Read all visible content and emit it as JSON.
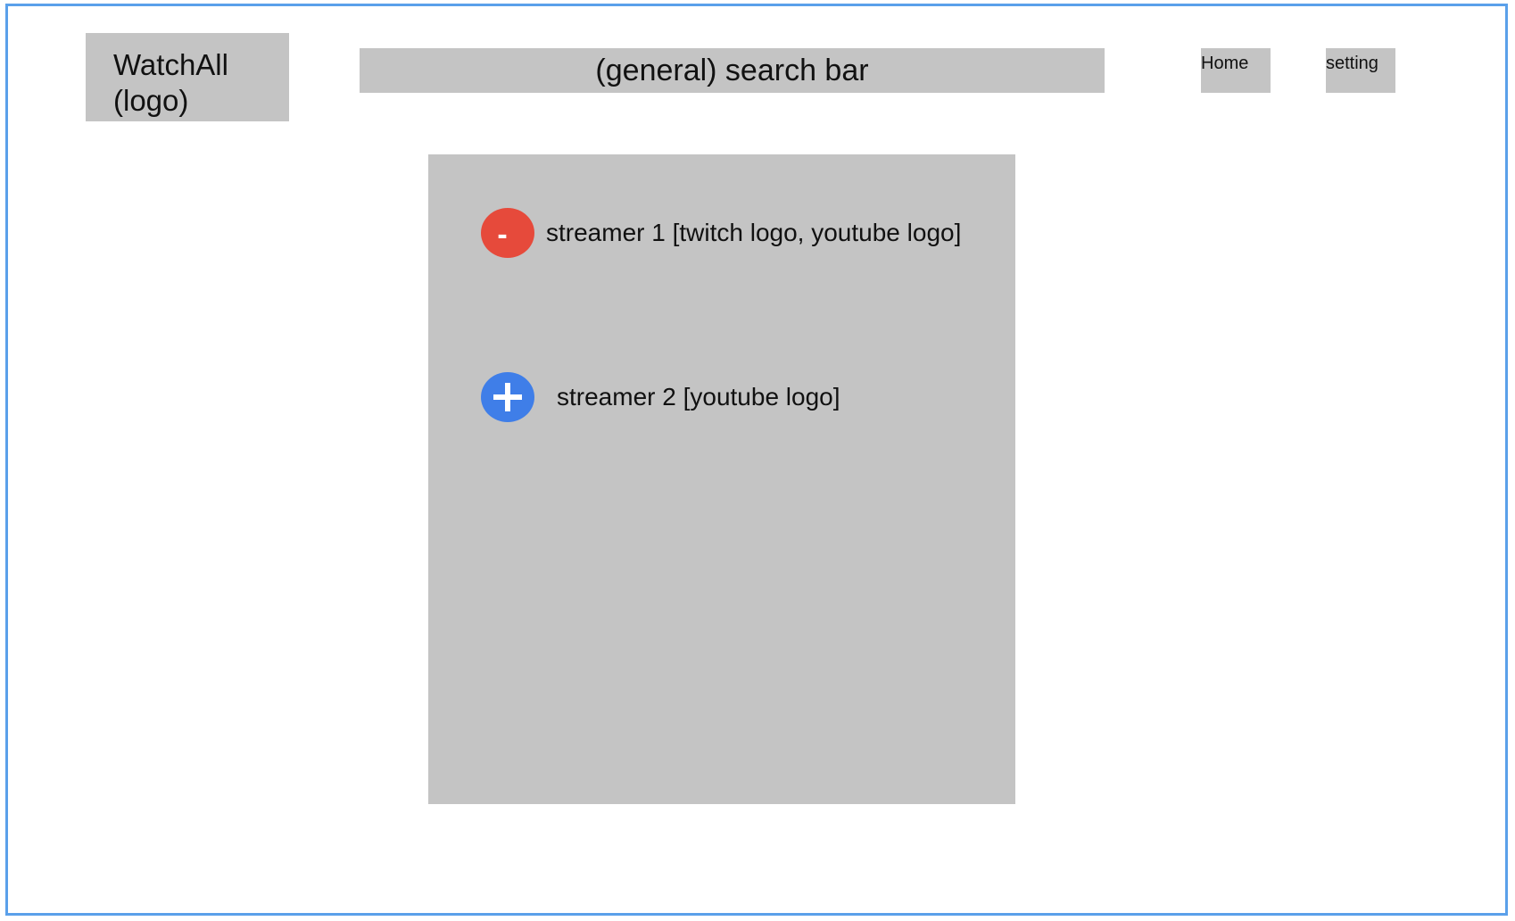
{
  "header": {
    "logo_label": "WatchAll (logo)",
    "search_placeholder": "(general) search bar",
    "nav": {
      "home": "Home",
      "setting": "setting"
    }
  },
  "main": {
    "streamers": [
      {
        "action_icon": "minus-icon",
        "label": "streamer 1 [twitch logo, youtube logo]"
      },
      {
        "action_icon": "plus-icon",
        "label": "streamer 2 [youtube logo]"
      }
    ]
  },
  "colors": {
    "frame_border": "#5aa0ea",
    "panel_gray": "#c4c4c4",
    "remove_button": "#e64a3b",
    "add_button": "#3f7ee8"
  }
}
